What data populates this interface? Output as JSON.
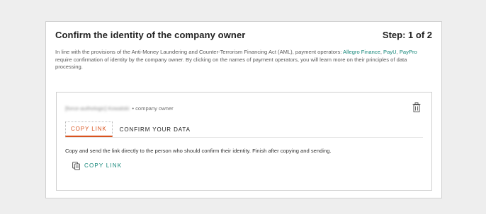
{
  "header": {
    "title": "Confirm the identity of the company owner",
    "step": "Step: 1 of 2"
  },
  "description": {
    "text_before": "In line with the provisions of the Anti-Money Laundering and Counter-Terrorism Financing Act (AML), payment operators: ",
    "link_allegro": "Allegro Finance",
    "separator1": ", ",
    "link_payu": "PayU",
    "separator2": ", ",
    "link_paypro": "PayPro",
    "text_after": " require confirmation of identity by the company owner. By clicking on the names of payment operators, you will learn more on their principles of data processing."
  },
  "owner": {
    "name": "[force-authologic] Kowalski",
    "role": "• company owner"
  },
  "tabs": [
    {
      "label": "COPY LINK",
      "active": true
    },
    {
      "label": "CONFIRM YOUR DATA",
      "active": false
    }
  ],
  "copy_section": {
    "instruction": "Copy and send the link directly to the person who should confirm their identity. Finish after copying and sending.",
    "button_label": "COPY LINK"
  },
  "colors": {
    "accent_orange": "#d9531e",
    "link_green": "#16877a"
  },
  "icons": {
    "delete": "trash-icon",
    "copy": "copy-icon"
  }
}
